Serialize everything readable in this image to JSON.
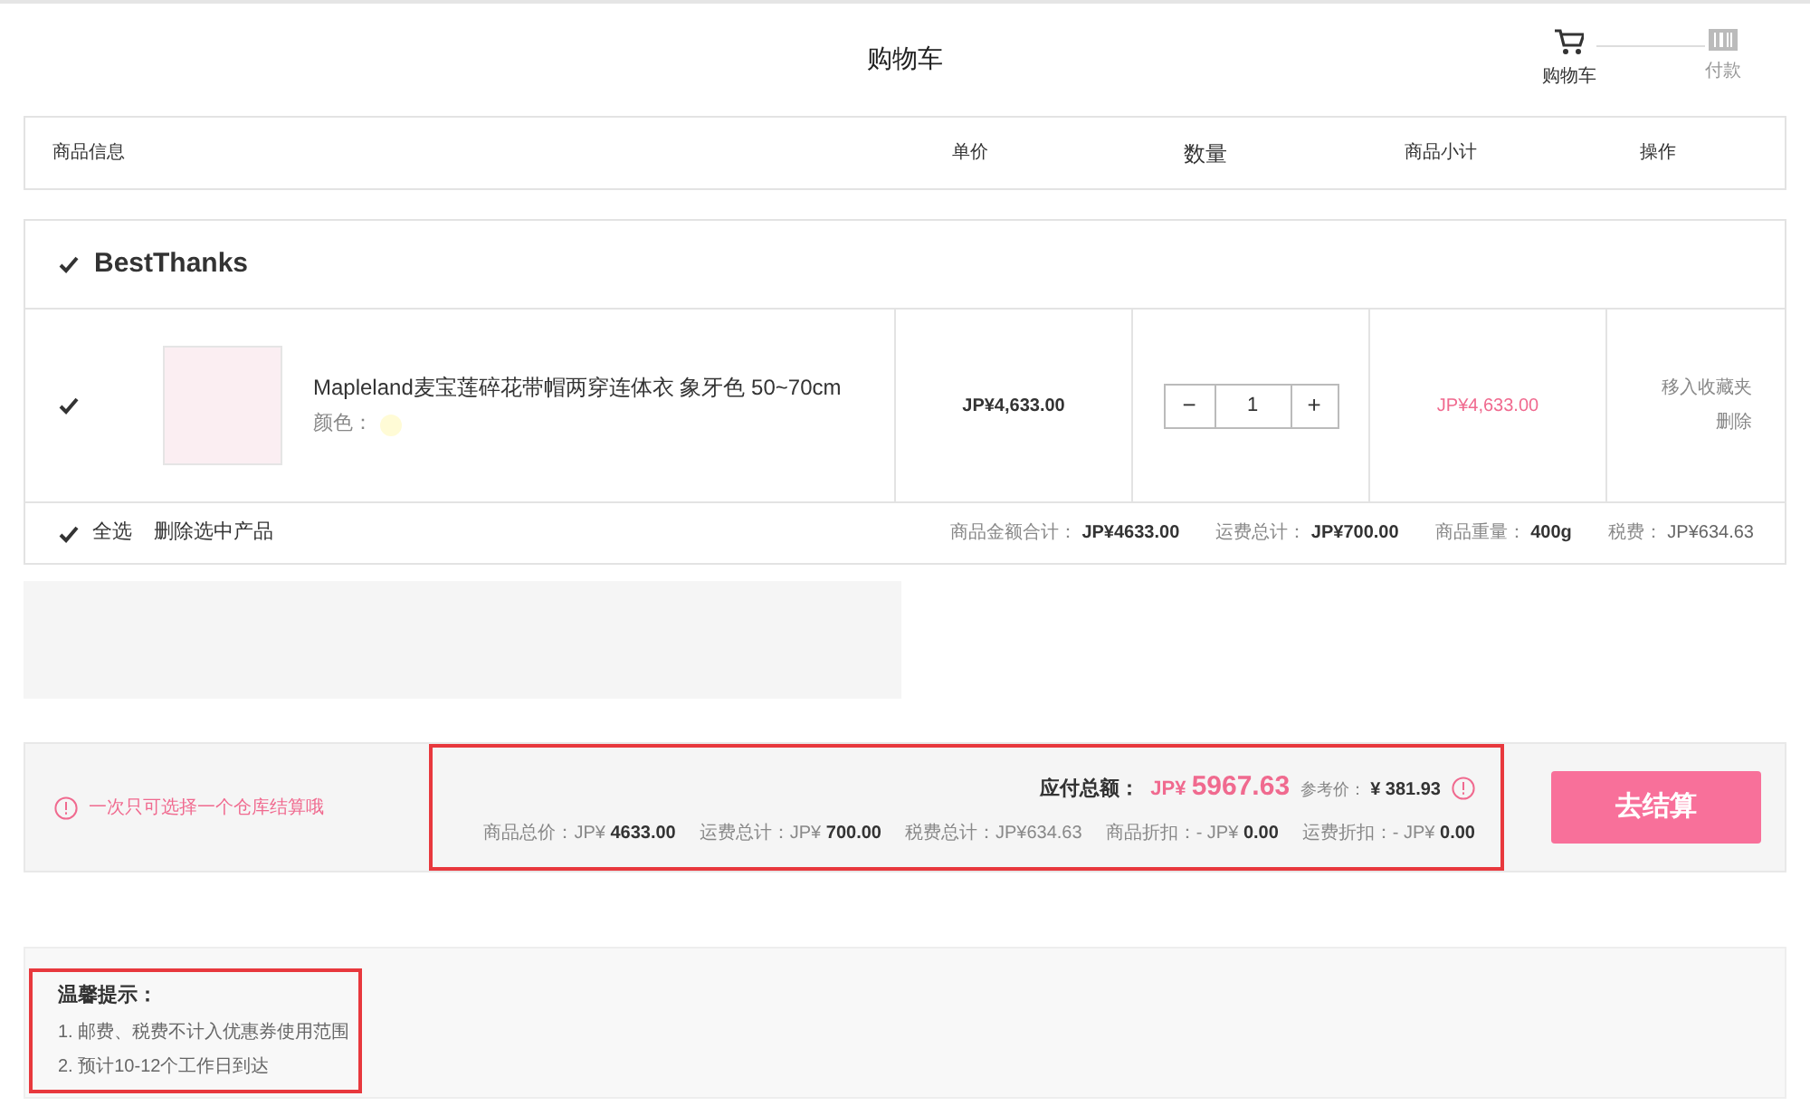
{
  "page_title": "购物车",
  "steps": [
    {
      "label": "购物车",
      "selected": true,
      "kind": "cart"
    },
    {
      "label": "付款",
      "selected": false,
      "kind": "pay"
    }
  ],
  "columns": [
    "商品信息",
    "单价",
    "数量",
    "商品小计",
    "操作"
  ],
  "shop": {
    "name": "BestThanks",
    "checked": true,
    "items": [
      {
        "checked": true,
        "title": "Mapleland麦宝莲碎花带帽两穿连体衣 象牙色 50~70cm",
        "color_label": "颜色：",
        "color": "#fffbd6",
        "price": "JP¥4,633.00",
        "minus": "−",
        "quantity": "1",
        "plus": "+",
        "subtotal": "JP¥4,633.00",
        "actions": [
          "移入收藏夹",
          "删除"
        ]
      }
    ],
    "select_all": {
      "label": "全选",
      "checked": true
    },
    "delete_selected": "删除选中产品",
    "totals": [
      {
        "label": "商品金额合计：",
        "value": "JP¥4633.00",
        "bold": true
      },
      {
        "label": "运费总计：",
        "value": "JP¥700.00",
        "bold": true
      },
      {
        "label": "商品重量：",
        "value": "400g",
        "bold": true
      },
      {
        "label": "税费：",
        "value": "JP¥634.63",
        "bold": false
      }
    ]
  },
  "checkout": {
    "notice": "一次只可选择一个仓库结算哦",
    "highlighted": true,
    "total_label": "应付总额：",
    "total_currency": "JP¥",
    "total_value": "5967.63",
    "ref_label": "参考价：",
    "ref_value": "¥ 381.93",
    "breakdown": [
      {
        "label": "商品总价：",
        "value": "JP¥ ",
        "strong": "4633.00"
      },
      {
        "label": "运费总计：",
        "value": "JP¥ ",
        "strong": "700.00"
      },
      {
        "label": "税费总计：",
        "value": "JP¥634.63"
      },
      {
        "label": "商品折扣：",
        "value": "- JP¥ ",
        "strong": "0.00"
      },
      {
        "label": "运费折扣：",
        "value": "- JP¥ ",
        "strong": "0.00"
      }
    ],
    "button": "去结算"
  },
  "tips": {
    "title": "温馨提示：",
    "highlighted": true,
    "lines": [
      "1. 邮费、税费不计入优惠券使用范围",
      "2. 预计10-12个工作日到达"
    ]
  }
}
